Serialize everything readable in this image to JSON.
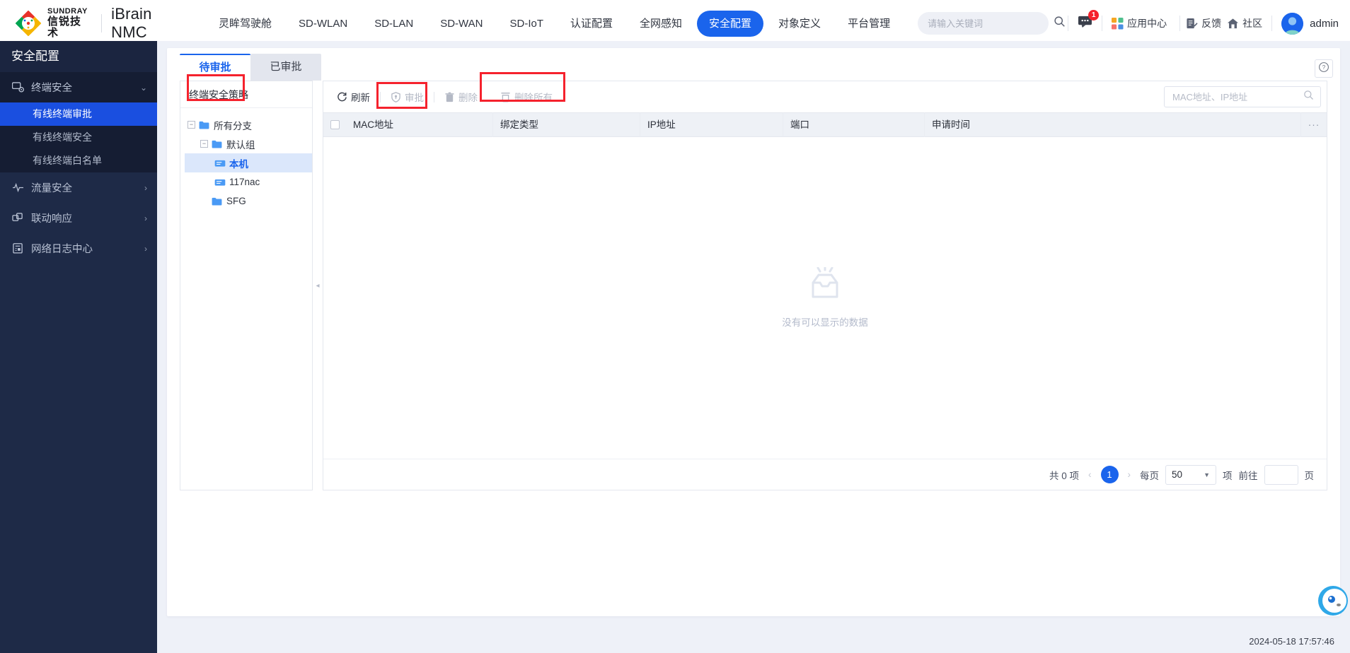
{
  "header": {
    "brand": {
      "en": "SUNDRAY",
      "cn": "信锐技术",
      "product": "iBrain NMC"
    },
    "nav": [
      {
        "label": "灵眸驾驶舱",
        "active": false
      },
      {
        "label": "SD-WLAN",
        "active": false
      },
      {
        "label": "SD-LAN",
        "active": false
      },
      {
        "label": "SD-WAN",
        "active": false
      },
      {
        "label": "SD-IoT",
        "active": false
      },
      {
        "label": "认证配置",
        "active": false
      },
      {
        "label": "全网感知",
        "active": false
      },
      {
        "label": "安全配置",
        "active": true
      },
      {
        "label": "对象定义",
        "active": false
      },
      {
        "label": "平台管理",
        "active": false
      }
    ],
    "search": {
      "placeholder": "请输入关键词",
      "value": ""
    },
    "message_badge": "1",
    "links": [
      {
        "label": "应用中心",
        "icon": "apps-grid-icon"
      },
      {
        "label": "反馈",
        "icon": "feedback-icon"
      },
      {
        "label": "社区",
        "icon": "home-community-icon"
      }
    ],
    "user": "admin"
  },
  "sidebar": {
    "title": "安全配置",
    "groups": [
      {
        "label": "终端安全",
        "icon": "terminal-security-icon",
        "expanded": true,
        "items": [
          {
            "label": "有线终端审批",
            "active": true
          },
          {
            "label": "有线终端安全",
            "active": false
          },
          {
            "label": "有线终端白名单",
            "active": false
          }
        ]
      },
      {
        "label": "流量安全",
        "icon": "traffic-security-icon",
        "expanded": false,
        "items": []
      },
      {
        "label": "联动响应",
        "icon": "linkage-response-icon",
        "expanded": false,
        "items": []
      },
      {
        "label": "网络日志中心",
        "icon": "network-log-icon",
        "expanded": false,
        "items": []
      }
    ]
  },
  "main": {
    "tabs": [
      {
        "label": "待审批",
        "active": true
      },
      {
        "label": "已审批",
        "active": false
      }
    ],
    "help_icon": "question-circle-icon",
    "tree": {
      "title": "终端安全策略",
      "nodes": [
        {
          "label": "所有分支",
          "type": "folder",
          "depth": 0,
          "toggle": "minus",
          "selected": false
        },
        {
          "label": "默认组",
          "type": "folder",
          "depth": 1,
          "toggle": "minus",
          "selected": false
        },
        {
          "label": "本机",
          "type": "device",
          "depth": 2,
          "toggle": "none",
          "selected": true
        },
        {
          "label": "117nac",
          "type": "device",
          "depth": 2,
          "toggle": "none",
          "selected": false
        },
        {
          "label": "SFG",
          "type": "folder",
          "depth": 1,
          "toggle": "none",
          "selected": false
        }
      ]
    },
    "toolbar": {
      "buttons": [
        {
          "label": "刷新",
          "icon": "refresh-icon",
          "disabled": false
        },
        {
          "label": "审批",
          "icon": "approve-shield-icon",
          "disabled": true
        },
        {
          "label": "删除",
          "icon": "trash-icon",
          "disabled": true
        },
        {
          "label": "删除所有",
          "icon": "delete-all-icon",
          "disabled": true
        }
      ],
      "search": {
        "placeholder": "MAC地址、IP地址",
        "value": ""
      }
    },
    "table": {
      "columns": [
        "MAC地址",
        "绑定类型",
        "IP地址",
        "端口",
        "申请时间"
      ],
      "rows": [],
      "empty_text": "没有可以显示的数据",
      "empty_icon": "empty-box-icon"
    },
    "pagination": {
      "total_text": "共 0 项",
      "current_page": "1",
      "per_page_label": "每页",
      "page_size": "50",
      "unit_label": "项",
      "goto_label": "前往",
      "goto_value": "",
      "page_unit": "页"
    }
  },
  "statusbar": {
    "datetime": "2024-05-18 17:57:46"
  },
  "colors": {
    "accent": "#1a64ec",
    "sidebar_bg": "#1e2a47",
    "sidebar_sub_bg": "#151d33",
    "highlight_box": "#f5222d",
    "page_bg": "#eef1f8"
  }
}
